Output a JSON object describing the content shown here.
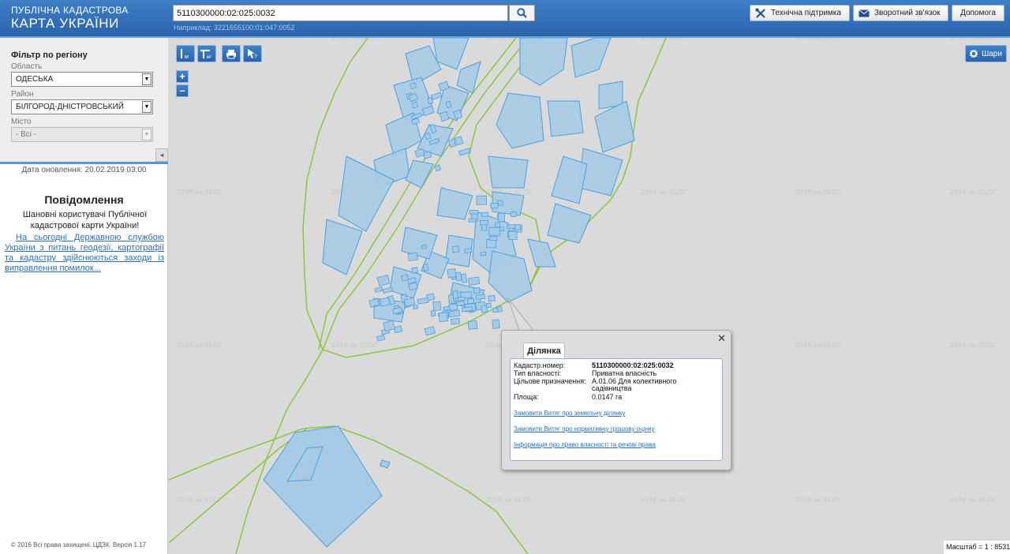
{
  "header": {
    "logo_line1": "ПУБЛІЧНА КАДАСТРОВА",
    "logo_line2": "КАРТА УКРАЇНИ",
    "search_value": "5110300000:02:025:0032",
    "search_hint": "Наприклад: 3221655100:01:047:0052",
    "btn_support": "Технічна підтримка",
    "btn_feedback": "Зворотний зв'язок",
    "btn_help": "Допомога"
  },
  "filter": {
    "title": "Фільтр по регіону",
    "oblast_label": "Область",
    "oblast_value": "ОДЕСЬКА",
    "raion_label": "Район",
    "raion_value": "БІЛГОРОД-ДНІСТРОВСЬКИЙ",
    "misto_label": "Місто",
    "misto_value": "- Всі -",
    "collapse_symbol": "◄"
  },
  "update": "Дата оновлення: 20.02.2019 03:00",
  "notice": {
    "title": "Повідомлення",
    "text": "Шановні користувачі Публічної кадастрової карти України!",
    "link": "На сьогодні Державною службою України з питань геодезії, картографії та кадастру здійснюються заходи із виправлення помилок..."
  },
  "copyright": "© 2016 Всі права захищені. ЦДЗК. Версія 1.17",
  "map": {
    "watermark": "2018.на.SLCC",
    "zoom_in": "+",
    "zoom_out": "–",
    "layers_label": "Шари",
    "scale": "Масштаб = 1 : 8531"
  },
  "popup": {
    "close": "✕",
    "tab": "Ділянка",
    "rows": [
      {
        "key": "Кадастр.номер:",
        "value": "5110300000:02:025:0032"
      },
      {
        "key": "Тип власності:",
        "value": "Приватна власність"
      },
      {
        "key": "Цільове призначення:",
        "value": "А.01.06 Для колективного садівництва"
      },
      {
        "key": "Площа:",
        "value": "0.0147 га"
      }
    ],
    "links": [
      "Замовити Витяг про земельну ділянку",
      "Замовити Витяг про нормативну грошову оцінку",
      "Інформація про право власності та речові права"
    ]
  },
  "colors": {
    "header": "#2f6db5",
    "parcel_fill": "#a7cbe6",
    "parcel_stroke": "#4aa0e0",
    "boundary": "#8cc63f"
  }
}
